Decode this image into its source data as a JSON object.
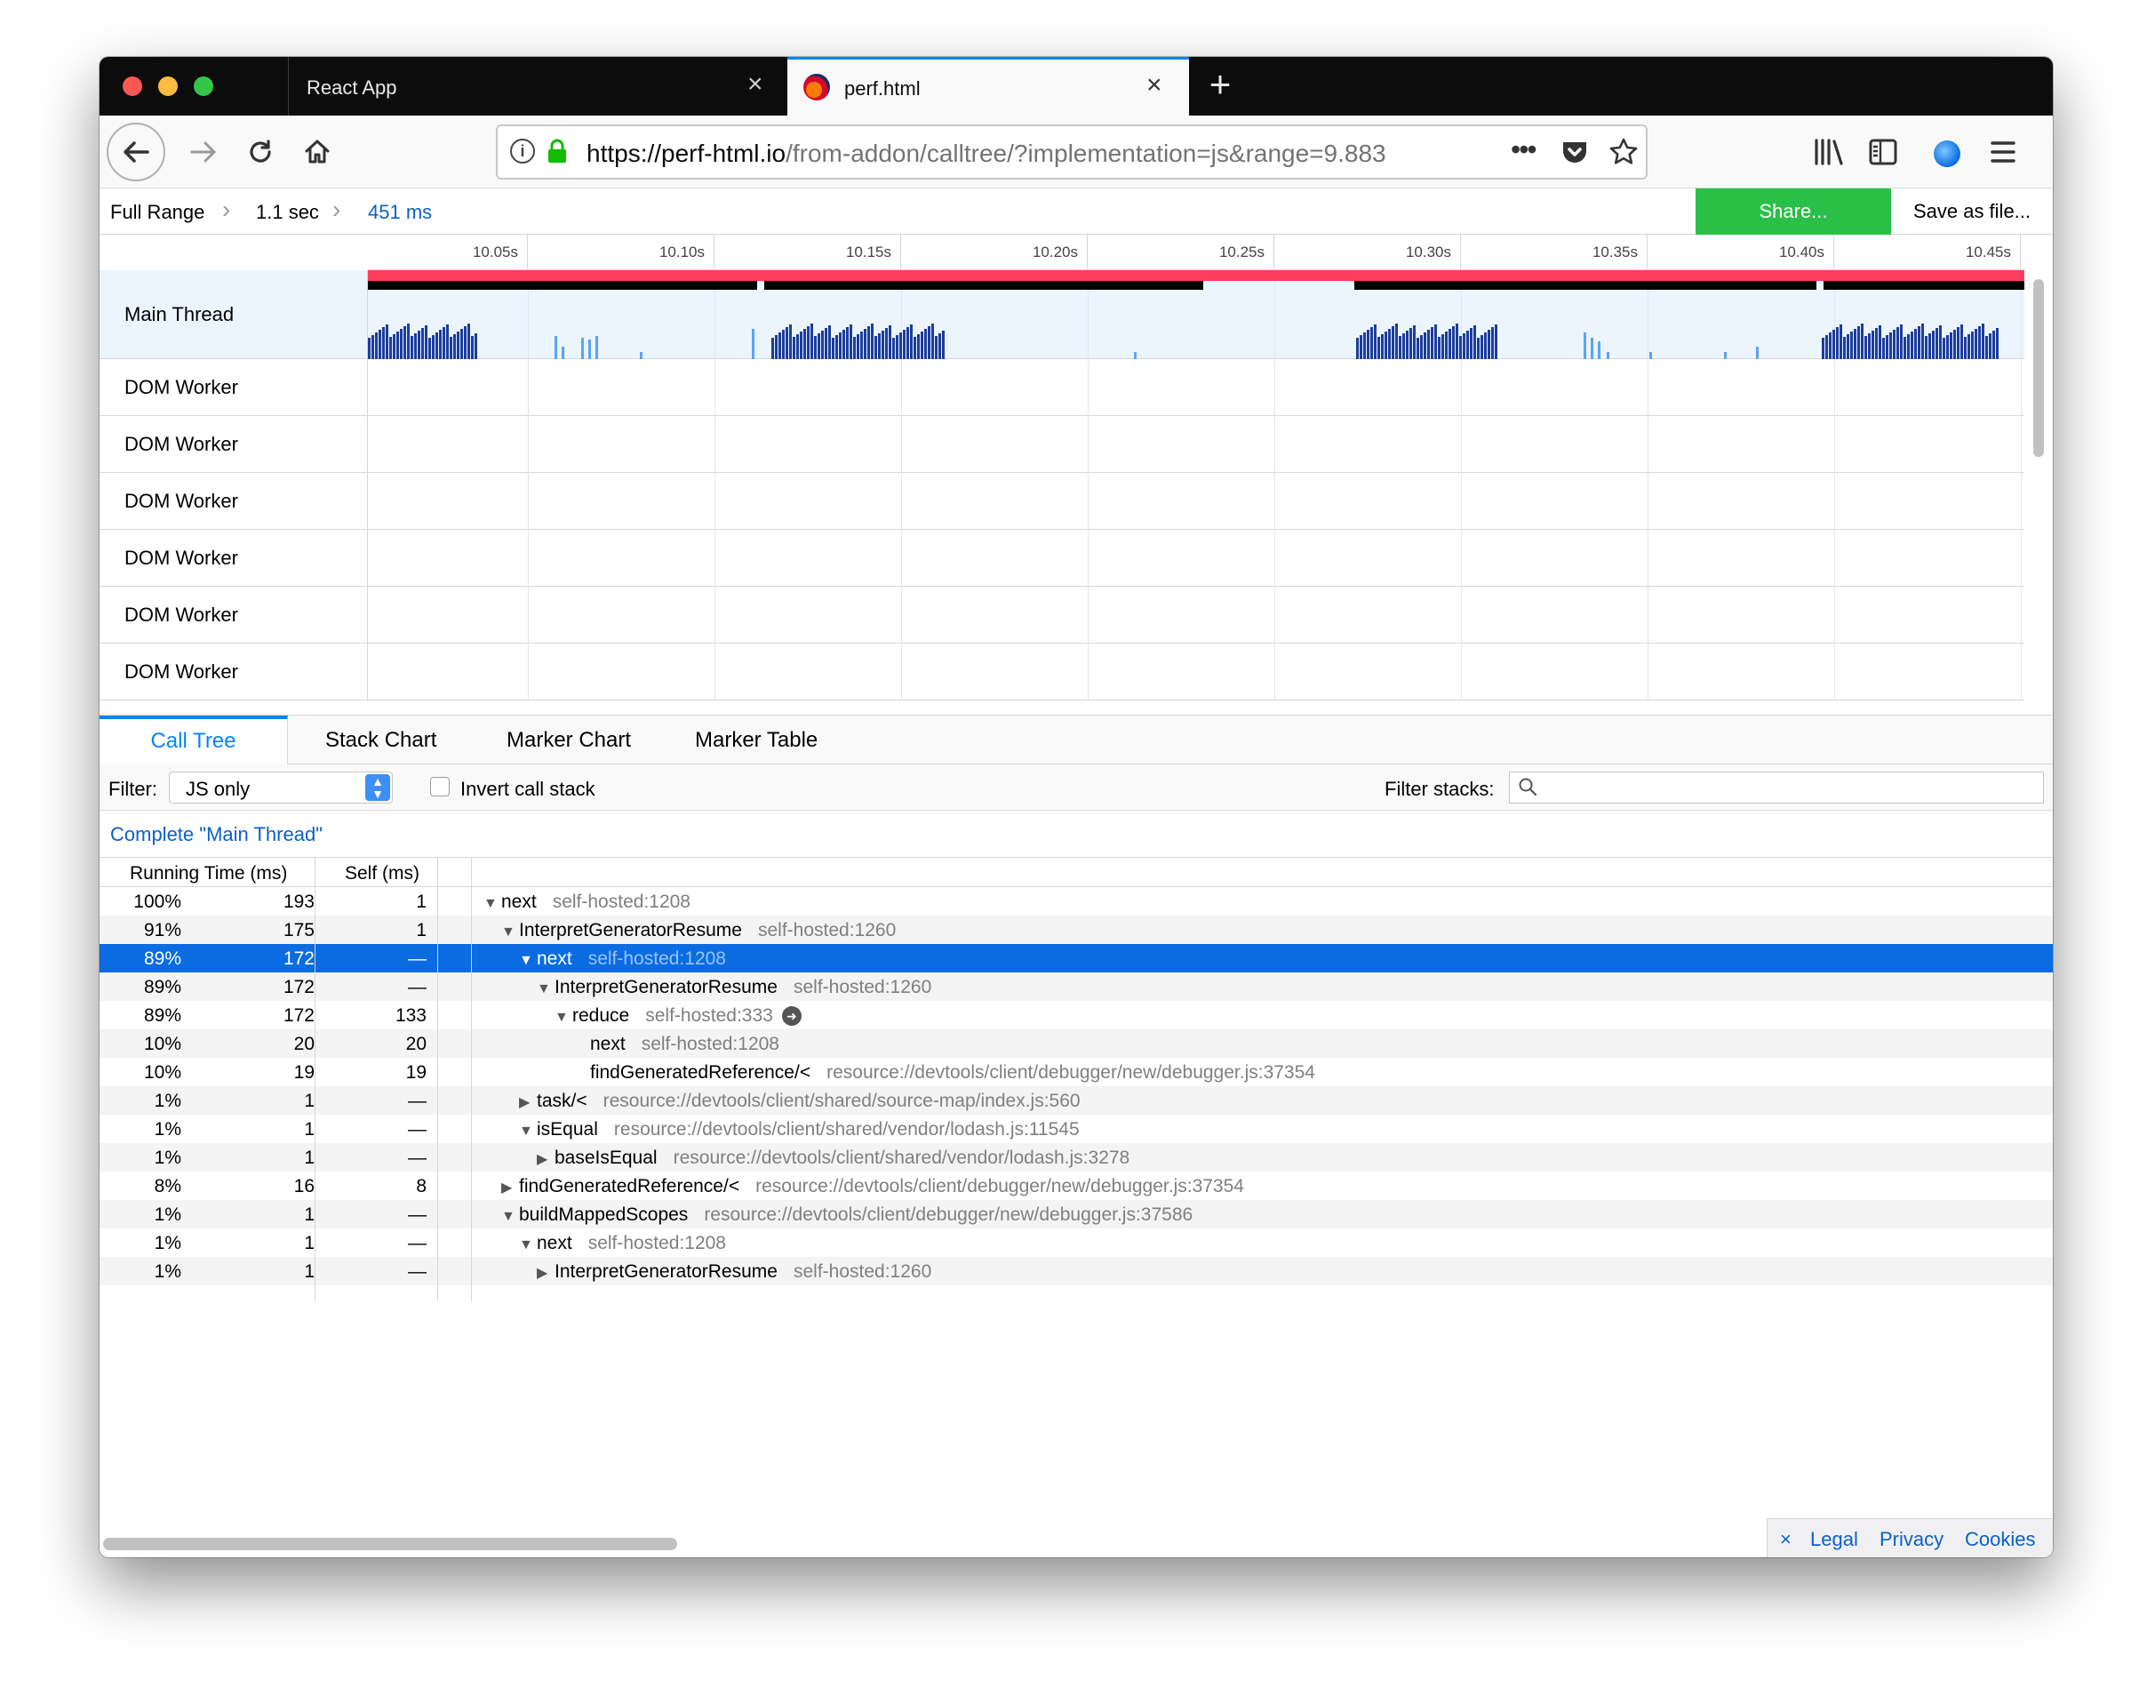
{
  "browser": {
    "tabs": [
      {
        "title": "React App"
      },
      {
        "title": "perf.html"
      }
    ],
    "url_host": "https://perf-html.io",
    "url_path": "/from-addon/calltree/?implementation=js&range=9.883"
  },
  "breadcrumb": {
    "items": [
      "Full Range",
      "1.1 sec",
      "451 ms"
    ],
    "share_label": "Share...",
    "save_label": "Save as file..."
  },
  "timeline": {
    "ticks": [
      "10.05s",
      "10.10s",
      "10.15s",
      "10.20s",
      "10.25s",
      "10.30s",
      "10.35s",
      "10.40s",
      "10.45s"
    ],
    "threads": [
      "Main Thread",
      "DOM Worker",
      "DOM Worker",
      "DOM Worker",
      "DOM Worker",
      "DOM Worker",
      "DOM Worker"
    ]
  },
  "panel": {
    "tabs": [
      "Call Tree",
      "Stack Chart",
      "Marker Chart",
      "Marker Table"
    ],
    "filter_label": "Filter:",
    "filter_value": "JS only",
    "invert_label": "Invert call stack",
    "stacks_label": "Filter stacks:",
    "thread_title": "Complete \"Main Thread\""
  },
  "tree": {
    "headers": [
      "Running Time (ms)",
      "Self (ms)"
    ],
    "rows": [
      {
        "pct": "100%",
        "ms": "193",
        "self": "1",
        "depth": 0,
        "twisty": "▼",
        "name": "next",
        "lib": "self-hosted:1208"
      },
      {
        "pct": "91%",
        "ms": "175",
        "self": "1",
        "depth": 1,
        "twisty": "▼",
        "name": "InterpretGeneratorResume",
        "lib": "self-hosted:1260"
      },
      {
        "pct": "89%",
        "ms": "172",
        "self": "—",
        "depth": 2,
        "twisty": "▼",
        "name": "next",
        "lib": "self-hosted:1208",
        "selected": true
      },
      {
        "pct": "89%",
        "ms": "172",
        "self": "—",
        "depth": 3,
        "twisty": "▼",
        "name": "InterpretGeneratorResume",
        "lib": "self-hosted:1260"
      },
      {
        "pct": "89%",
        "ms": "172",
        "self": "133",
        "depth": 4,
        "twisty": "▼",
        "name": "reduce",
        "lib": "self-hosted:333",
        "arrow": "➜"
      },
      {
        "pct": "10%",
        "ms": "20",
        "self": "20",
        "depth": 5,
        "twisty": "",
        "name": "next",
        "lib": "self-hosted:1208"
      },
      {
        "pct": "10%",
        "ms": "19",
        "self": "19",
        "depth": 5,
        "twisty": "",
        "name": "findGeneratedReference/<",
        "lib": "resource://devtools/client/debugger/new/debugger.js:37354"
      },
      {
        "pct": "1%",
        "ms": "1",
        "self": "—",
        "depth": 2,
        "twisty": "▶",
        "name": "task/<",
        "lib": "resource://devtools/client/shared/source-map/index.js:560"
      },
      {
        "pct": "1%",
        "ms": "1",
        "self": "—",
        "depth": 2,
        "twisty": "▼",
        "name": "isEqual",
        "lib": "resource://devtools/client/shared/vendor/lodash.js:11545"
      },
      {
        "pct": "1%",
        "ms": "1",
        "self": "—",
        "depth": 3,
        "twisty": "▶",
        "name": "baseIsEqual",
        "lib": "resource://devtools/client/shared/vendor/lodash.js:3278"
      },
      {
        "pct": "8%",
        "ms": "16",
        "self": "8",
        "depth": 1,
        "twisty": "▶",
        "name": "findGeneratedReference/<",
        "lib": "resource://devtools/client/debugger/new/debugger.js:37354"
      },
      {
        "pct": "1%",
        "ms": "1",
        "self": "—",
        "depth": 1,
        "twisty": "▼",
        "name": "buildMappedScopes",
        "lib": "resource://devtools/client/debugger/new/debugger.js:37586"
      },
      {
        "pct": "1%",
        "ms": "1",
        "self": "—",
        "depth": 2,
        "twisty": "▼",
        "name": "next",
        "lib": "self-hosted:1208"
      },
      {
        "pct": "1%",
        "ms": "1",
        "self": "—",
        "depth": 3,
        "twisty": "▶",
        "name": "InterpretGeneratorResume",
        "lib": "self-hosted:1260"
      }
    ]
  },
  "footer": {
    "close": "×",
    "links": [
      "Legal",
      "Privacy",
      "Cookies"
    ]
  },
  "colors": {
    "accent": "#0a84ff",
    "selected_row": "#0a6ce0",
    "share_green": "#2ac048",
    "marker_red": "#ff3d5e",
    "graph_dark": "#1c3d9c",
    "graph_light": "#59a5f5"
  },
  "icons": {
    "back": "arrow-left-icon",
    "forward": "arrow-right-icon",
    "reload": "reload-icon",
    "home": "home-icon",
    "more": "ellipsis-icon",
    "pocket": "pocket-icon",
    "bookmark": "star-icon",
    "library": "library-icon",
    "sidebar": "sidebar-icon",
    "menu": "hamburger-icon",
    "search": "search-icon"
  }
}
